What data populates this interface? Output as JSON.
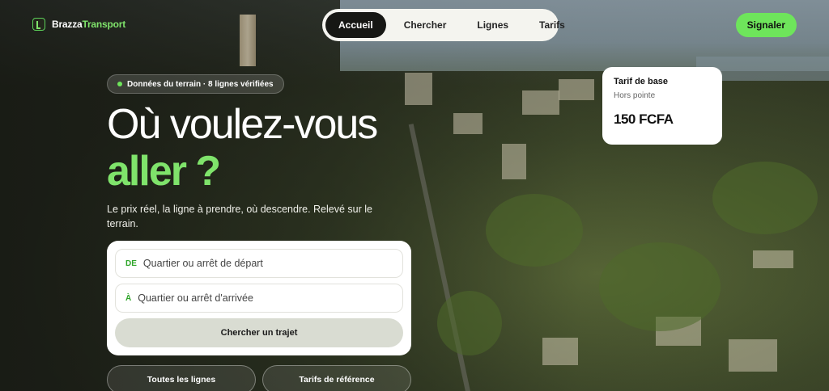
{
  "brand": {
    "name_part1": "Brazza",
    "name_part2": "Transport"
  },
  "nav": {
    "items": [
      {
        "label": "Accueil",
        "active": true
      },
      {
        "label": "Chercher",
        "active": false
      },
      {
        "label": "Lignes",
        "active": false
      },
      {
        "label": "Tarifs",
        "active": false
      }
    ]
  },
  "header": {
    "report_label": "Signaler"
  },
  "badge": {
    "text": "Données du terrain · 8 lignes vérifiées"
  },
  "hero": {
    "title_line1": "Où voulez-vous",
    "title_line2": "aller ?",
    "subtitle": "Le prix réel, la ligne à prendre, où descendre. Relevé sur le terrain."
  },
  "search": {
    "from_tag": "DE",
    "from_placeholder": "Quartier ou arrêt de départ",
    "to_tag": "À",
    "to_placeholder": "Quartier ou arrêt d'arrivée",
    "submit_label": "Chercher un trajet"
  },
  "links": {
    "all_lines": "Toutes les lignes",
    "reference_fares": "Tarifs de référence"
  },
  "fare": {
    "title": "Tarif de base",
    "subtitle": "Hors pointe",
    "price": "150 FCFA"
  },
  "colors": {
    "accent": "#6ee55b",
    "nav_active": "#161714",
    "card": "#ffffff"
  }
}
